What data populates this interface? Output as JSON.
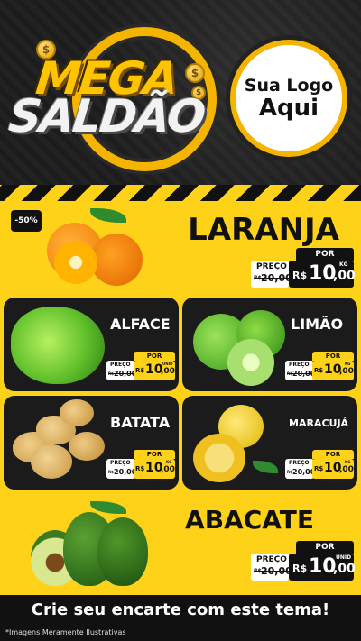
{
  "header": {
    "title_line1": "MEGA",
    "title_line2": "SALDÃO",
    "coin_symbol": "$",
    "logo_line1": "Sua Logo",
    "logo_line2": "Aqui"
  },
  "colors": {
    "accent": "#ffd21a",
    "dark": "#111111",
    "gold": "#f4b400"
  },
  "products": {
    "laranja": {
      "name": "LARANJA",
      "badge": "-50%",
      "por": "POR",
      "preco_label": "PREÇO",
      "old_currency": "R$",
      "old_price": "20,00",
      "currency": "R$",
      "price_int": "10",
      "price_dec": ",00",
      "unit": "KG"
    },
    "alface": {
      "name": "ALFACE",
      "por": "POR",
      "preco_label": "PREÇO",
      "old_currency": "R$",
      "old_price": "20,00",
      "currency": "R$",
      "price_int": "10",
      "price_dec": ",00",
      "unit": "UNID"
    },
    "limao": {
      "name": "LIMÃO",
      "por": "POR",
      "preco_label": "PREÇO",
      "old_currency": "R$",
      "old_price": "20,00",
      "currency": "R$",
      "price_int": "10",
      "price_dec": ",00",
      "unit": "KG"
    },
    "batata": {
      "name": "BATATA",
      "por": "POR",
      "preco_label": "PREÇO",
      "old_currency": "R$",
      "old_price": "20,00",
      "currency": "R$",
      "price_int": "10",
      "price_dec": ",00",
      "unit": "KG"
    },
    "maracuja": {
      "name": "MARACUJÁ",
      "por": "POR",
      "preco_label": "PREÇO",
      "old_currency": "R$",
      "old_price": "20,00",
      "currency": "R$",
      "price_int": "10",
      "price_dec": ",00",
      "unit": "KG"
    },
    "abacate": {
      "name": "ABACATE",
      "por": "POR",
      "preco_label": "PREÇO",
      "old_currency": "R$",
      "old_price": "20,00",
      "currency": "R$",
      "price_int": "10",
      "price_dec": ",00",
      "unit": "UNID"
    }
  },
  "footer": {
    "cta": "Crie seu encarte com este tema!",
    "disclaimer": "*Imagens Meramente Ilustrativas"
  }
}
